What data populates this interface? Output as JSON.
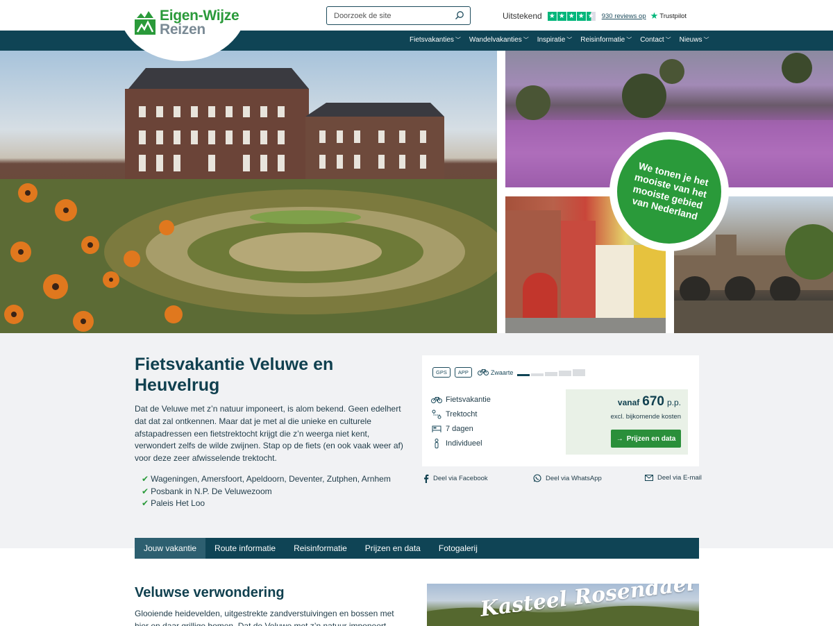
{
  "brand": {
    "line1": "Eigen-Wijze",
    "line2": "Reizen",
    "green": "#2a9a3a",
    "navy": "#0f4455"
  },
  "search": {
    "placeholder": "Doorzoek de site"
  },
  "trustpilot": {
    "rating_label": "Uitstekend",
    "stars": 4.5,
    "reviews": "930 reviews op",
    "brand": "Trustpilot"
  },
  "nav": {
    "items": [
      {
        "label": "Fietsvakanties"
      },
      {
        "label": "Wandelvakanties"
      },
      {
        "label": "Inspiratie"
      },
      {
        "label": "Reisinformatie"
      },
      {
        "label": "Contact"
      },
      {
        "label": "Nieuws"
      }
    ]
  },
  "hero": {
    "badge": "We tonen je het mooiste van het mooiste gebied van Nederland"
  },
  "intro": {
    "title": "Fietsvakantie Veluwe en Heuvelrug",
    "text": "Dat de Veluwe met z’n natuur imponeert, is alom bekend. Geen edelhert dat dat zal ontkennen. Maar dat je met al die unieke en culturele afstapadressen een fietstrektocht krijgt die z’n weerga niet kent, verwondert zelfs de wilde zwijnen. Stap op de fiets (en ook vaak weer af) voor deze zeer afwisselende trektocht.",
    "highlights": [
      "Wageningen, Amersfoort, Apeldoorn, Deventer, Zutphen, Arnhem",
      "Posbank in N.P. De Veluwezoom",
      "Paleis Het Loo"
    ]
  },
  "card": {
    "tags": [
      "GPS",
      "APP"
    ],
    "difficulty_label": "Zwaarte",
    "difficulty_level": 1,
    "difficulty_max": 5,
    "features": [
      {
        "icon": "bicycle-icon",
        "label": "Fietsvakantie"
      },
      {
        "icon": "route-icon",
        "label": "Trektocht"
      },
      {
        "icon": "bed-icon",
        "label": "7 dagen"
      },
      {
        "icon": "person-icon",
        "label": "Individueel"
      }
    ],
    "price_from": "vanaf",
    "price": "670",
    "price_unit": "p.p.",
    "price_note": "excl. bijkomende kosten",
    "cta": "Prijzen en data"
  },
  "share": {
    "facebook": "Deel via Facebook",
    "whatsapp": "Deel via WhatsApp",
    "email": "Deel via E-mail"
  },
  "tabs": [
    {
      "label": "Jouw vakantie",
      "active": true
    },
    {
      "label": "Route informatie"
    },
    {
      "label": "Reisinformatie"
    },
    {
      "label": "Prijzen en data"
    },
    {
      "label": "Fotogalerij"
    }
  ],
  "section": {
    "title": "Veluwse verwondering",
    "text": "Glooiende heidevelden, uitgestrekte zandverstuivingen en bossen met hier en daar grillige bomen. Dat de Veluwe met z’n natuur imponeert, weten we",
    "image_script": "Kasteel Rosendael"
  }
}
